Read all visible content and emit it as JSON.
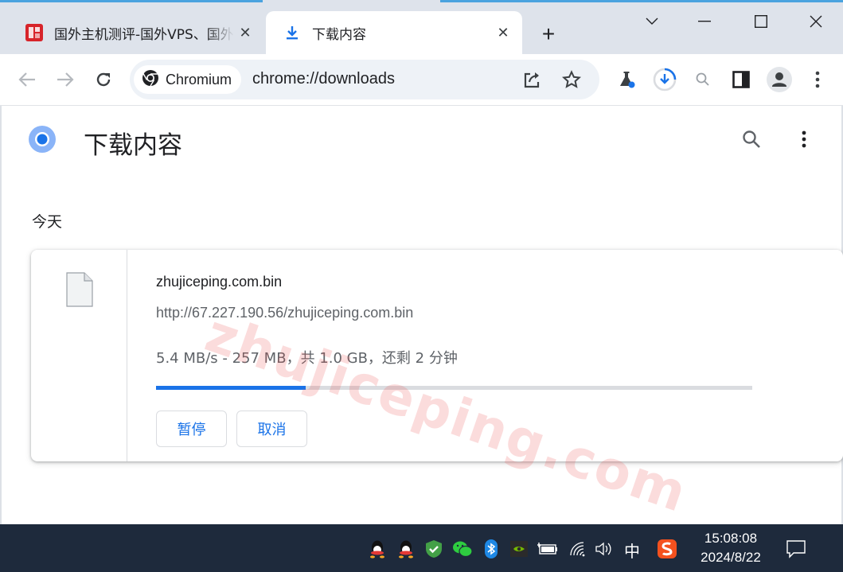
{
  "tabs": [
    {
      "title": "国外主机测评-国外VPS、国外服务器",
      "active": false
    },
    {
      "title": "下载内容",
      "active": true
    }
  ],
  "toolbar": {
    "chip_label": "Chromium",
    "url": "chrome://downloads"
  },
  "page": {
    "title": "下载内容",
    "section_label": "今天"
  },
  "download": {
    "file_name": "zhujiceping.com.bin",
    "source_url": "http://67.227.190.56/zhujiceping.com.bin",
    "status": "5.4 MB/s - 257 MB，共 1.0 GB，还剩 2 分钟",
    "progress_fraction": 0.251,
    "pause_label": "暂停",
    "cancel_label": "取消"
  },
  "watermark": "zhujiceping.com",
  "taskbar": {
    "ime": "中",
    "time": "15:08:08",
    "date": "2024/8/22"
  },
  "colors": {
    "accent": "#1a73e8",
    "tabstrip": "#dee3eb",
    "taskbar": "#1e2a3c"
  }
}
